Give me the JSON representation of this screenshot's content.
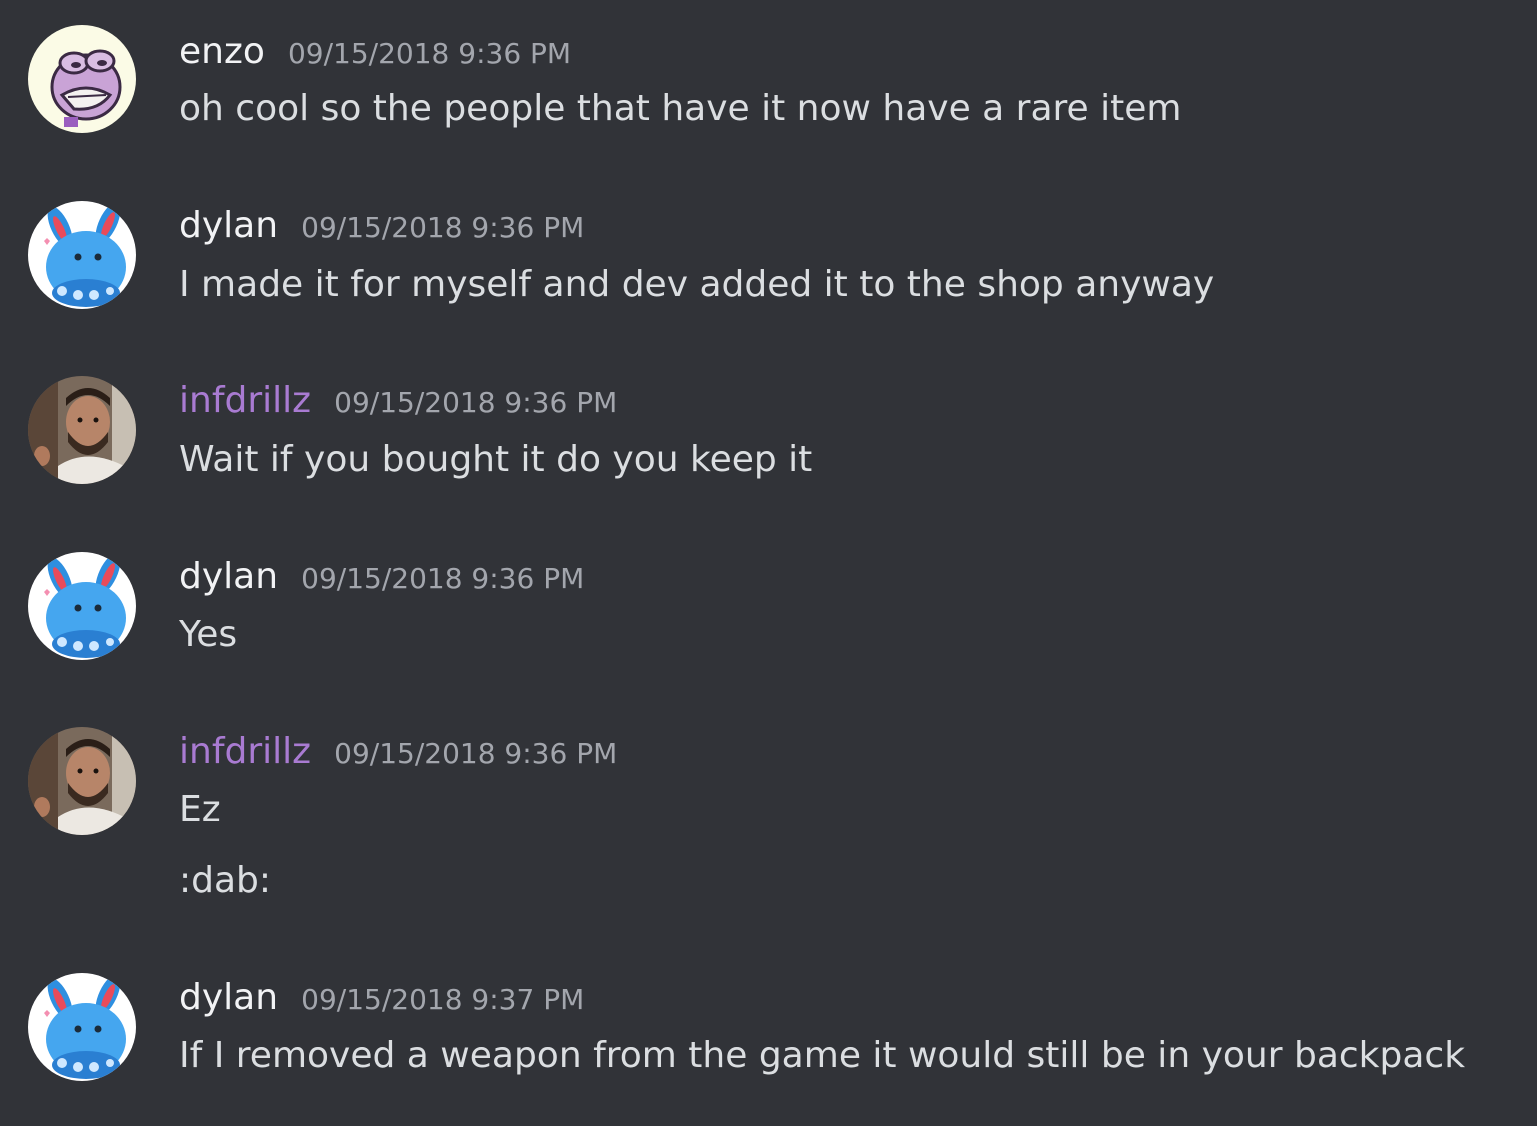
{
  "colors": {
    "background": "#313338",
    "username_default": "#f2f3f5",
    "username_purple": "#a97bd2",
    "timestamp": "#a3a6ad",
    "message_text": "#dbdee1"
  },
  "messages": [
    {
      "username": "enzo",
      "timestamp": "09/15/2018 9:36 PM",
      "avatar_icon": "pepe-frog-avatar",
      "lines": [
        "oh cool so the people that have it now have a rare item"
      ]
    },
    {
      "username": "dylan",
      "timestamp": "09/15/2018 9:36 PM",
      "avatar_icon": "azumarill-avatar",
      "lines": [
        "I made it for myself and dev added it to the shop anyway"
      ]
    },
    {
      "username": "infdrillz",
      "timestamp": "09/15/2018 9:36 PM",
      "avatar_icon": "bearded-man-photo-avatar",
      "lines": [
        "Wait if you bought it do you keep it"
      ]
    },
    {
      "username": "dylan",
      "timestamp": "09/15/2018 9:36 PM",
      "avatar_icon": "azumarill-avatar",
      "lines": [
        "Yes"
      ]
    },
    {
      "username": "infdrillz",
      "timestamp": "09/15/2018 9:36 PM",
      "avatar_icon": "bearded-man-photo-avatar",
      "lines": [
        "Ez",
        ":dab:"
      ]
    },
    {
      "username": "dylan",
      "timestamp": "09/15/2018 9:37 PM",
      "avatar_icon": "azumarill-avatar",
      "lines": [
        "If I removed a weapon from the game it would still be in your backpack"
      ]
    }
  ]
}
